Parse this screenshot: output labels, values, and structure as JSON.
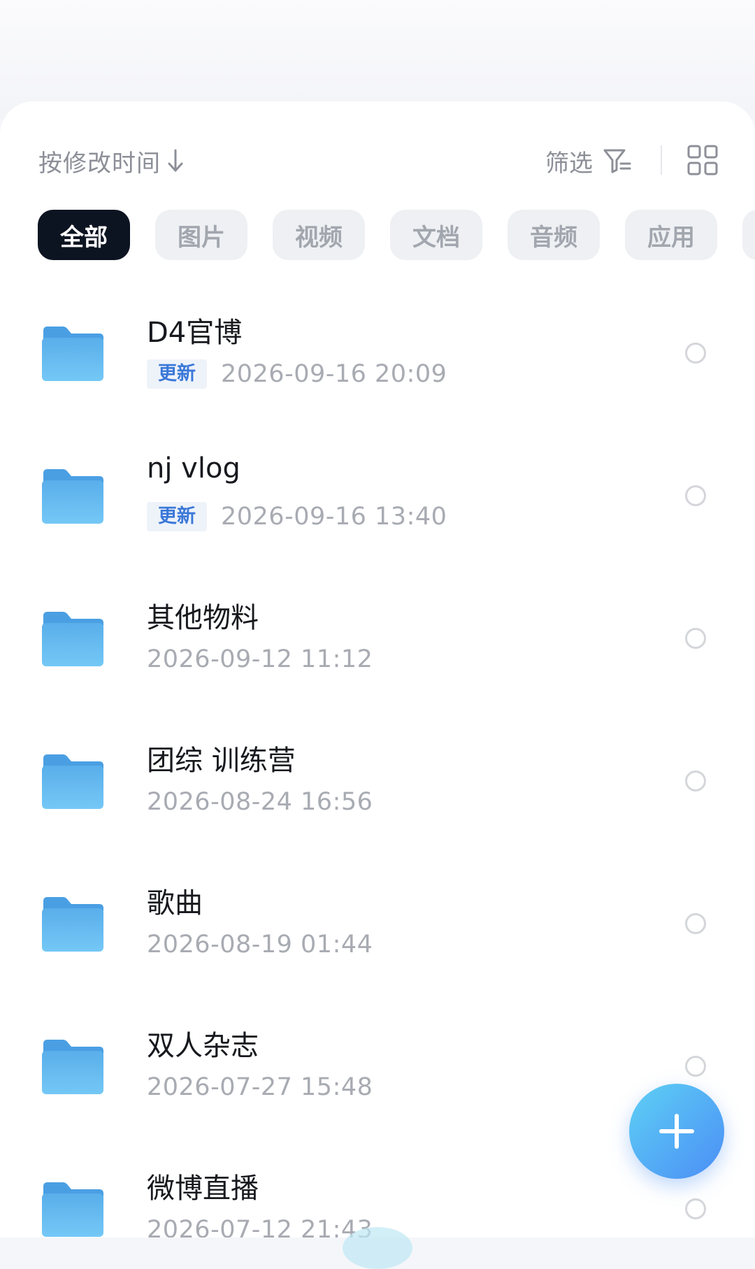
{
  "toolbar": {
    "sort_label": "按修改时间",
    "filter_label": "筛选"
  },
  "categories": [
    {
      "label": "全部",
      "active": true
    },
    {
      "label": "图片",
      "active": false
    },
    {
      "label": "视频",
      "active": false
    },
    {
      "label": "文档",
      "active": false
    },
    {
      "label": "音频",
      "active": false
    },
    {
      "label": "应用",
      "active": false
    }
  ],
  "files": [
    {
      "name": "D4官博",
      "badge": "更新",
      "date": "2026-09-16  20:09"
    },
    {
      "name": "nj vlog",
      "badge": "更新",
      "date": "2026-09-16  13:40"
    },
    {
      "name": "其他物料",
      "badge": "",
      "date": "2026-09-12  11:12"
    },
    {
      "name": "团综  训练营",
      "badge": "",
      "date": "2026-08-24  16:56"
    },
    {
      "name": "歌曲",
      "badge": "",
      "date": "2026-08-19  01:44"
    },
    {
      "name": "双人杂志",
      "badge": "",
      "date": "2026-07-27  15:48"
    },
    {
      "name": "微博直播",
      "badge": "",
      "date": "2026-07-12  21:43"
    }
  ],
  "colors": {
    "active_chip": "#0d1421",
    "badge_text": "#3b78d8",
    "folder": "#5ab4ee",
    "fab_start": "#5ed0f5",
    "fab_end": "#4b8ef5"
  },
  "icons": {
    "sort": "arrow-down-icon",
    "filter": "filter-icon",
    "view": "grid-view-icon",
    "item": "folder-icon",
    "fab": "plus-icon"
  }
}
